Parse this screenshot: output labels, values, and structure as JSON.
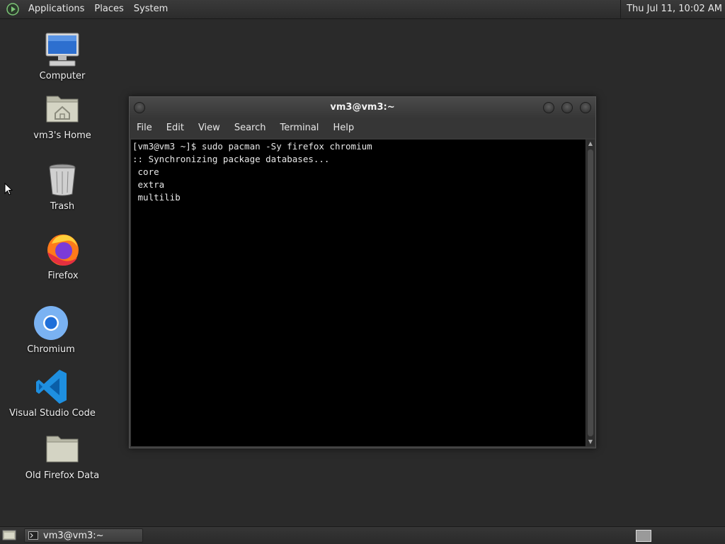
{
  "top_panel": {
    "menus": [
      "Applications",
      "Places",
      "System"
    ],
    "clock": "Thu Jul 11, 10:02 AM"
  },
  "desktop_icons": [
    {
      "label": "Computer",
      "icon": "computer-icon"
    },
    {
      "label": "vm3's Home",
      "icon": "home-folder-icon"
    },
    {
      "label": "Trash",
      "icon": "trash-icon"
    },
    {
      "label": "Firefox",
      "icon": "firefox-icon"
    },
    {
      "label": "Chromium",
      "icon": "chromium-icon"
    },
    {
      "label": "Visual Studio Code",
      "icon": "vscode-icon"
    },
    {
      "label": "Old Firefox Data",
      "icon": "folder-icon"
    }
  ],
  "terminal": {
    "title": "vm3@vm3:~",
    "menus": [
      "File",
      "Edit",
      "View",
      "Search",
      "Terminal",
      "Help"
    ],
    "lines": [
      "[vm3@vm3 ~]$ sudo pacman -Sy firefox chromium",
      ":: Synchronizing package databases...",
      " core",
      " extra",
      " multilib"
    ]
  },
  "taskbar": {
    "task_label": "vm3@vm3:~"
  },
  "colors": {
    "desktop_bg": "#2a2a2a",
    "terminal_bg": "#000000",
    "terminal_fg": "#e8e8e8"
  }
}
